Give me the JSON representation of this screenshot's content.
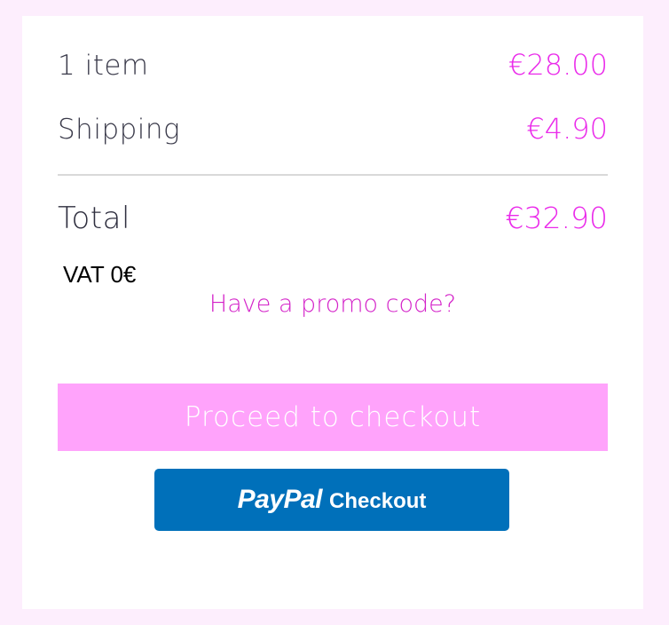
{
  "summary": {
    "items": {
      "label": "1 item",
      "value": "€28.00"
    },
    "shipping": {
      "label": "Shipping",
      "value": "€4.90"
    },
    "total": {
      "label": "Total",
      "value": "€32.90"
    },
    "vat": "VAT 0€"
  },
  "promo": {
    "label": "Have a promo code?"
  },
  "checkout": {
    "label": "Proceed to checkout"
  },
  "paypal": {
    "logo": "PayPal",
    "label": "Checkout"
  },
  "colors": {
    "accent": "#ea2bea",
    "checkout_button": "#ffa3fb",
    "paypal_button": "#0070ba",
    "background": "#fdeefd"
  }
}
